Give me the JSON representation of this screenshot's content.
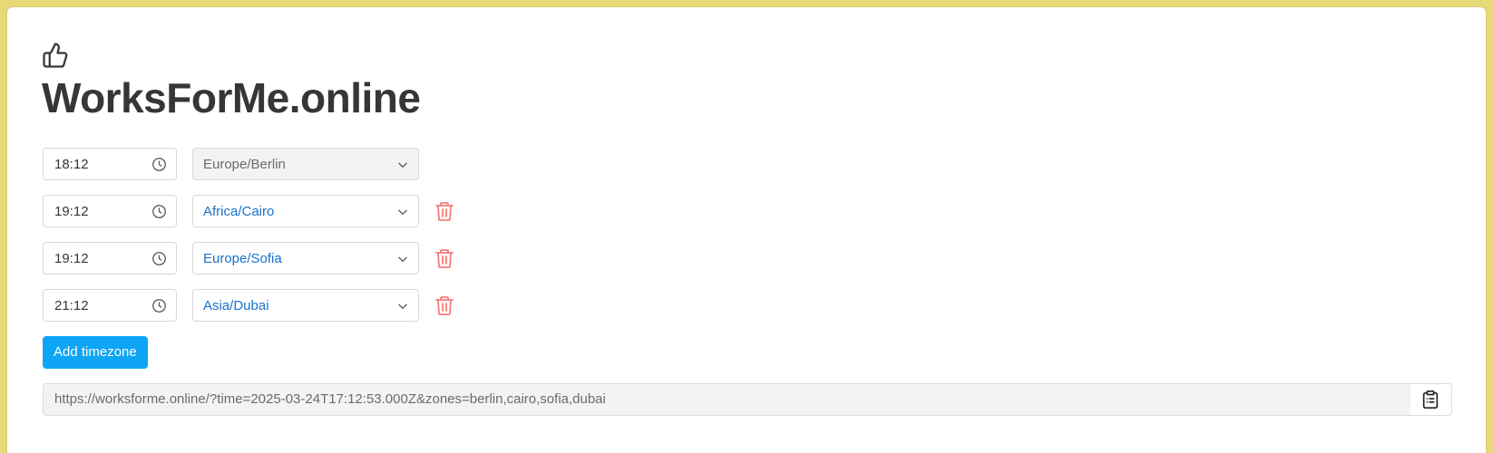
{
  "app": {
    "title": "WorksForMe.online",
    "logo_icon": "thumbs-up-icon"
  },
  "rows": [
    {
      "time": "18:12",
      "timezone": "Europe/Berlin",
      "removable": false
    },
    {
      "time": "19:12",
      "timezone": "Africa/Cairo",
      "removable": true
    },
    {
      "time": "19:12",
      "timezone": "Europe/Sofia",
      "removable": true
    },
    {
      "time": "21:12",
      "timezone": "Asia/Dubai",
      "removable": true
    }
  ],
  "actions": {
    "add_label": "Add timezone"
  },
  "share": {
    "url": "https://worksforme.online/?time=2025-03-24T17:12:53.000Z&zones=berlin,cairo,sofia,dubai",
    "copy_icon": "clipboard-icon"
  },
  "colors": {
    "page_background": "#e8d978",
    "accent": "#0ea5f5",
    "link_text": "#1a73c9",
    "delete": "#f47c7c",
    "title_text": "#363636"
  }
}
